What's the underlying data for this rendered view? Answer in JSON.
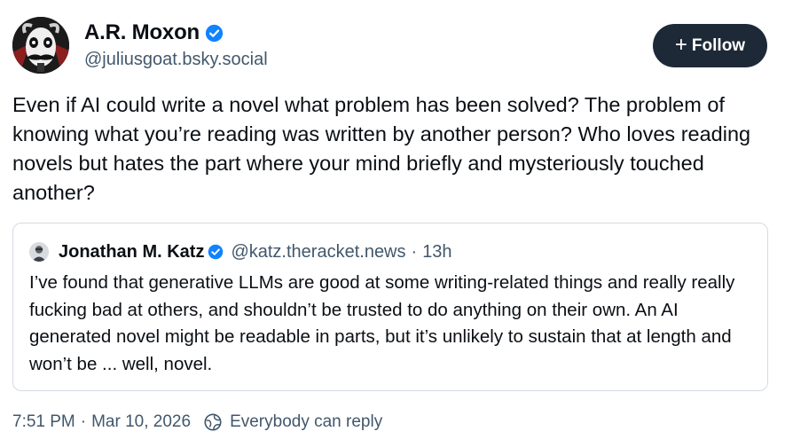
{
  "author": {
    "display_name": "A.R. Moxon",
    "handle": "@juliusgoat.bsky.social",
    "verified": true
  },
  "follow_button": {
    "label": "Follow",
    "icon": "plus-icon"
  },
  "post": {
    "text": "Even if AI could write a novel what problem has been solved? The problem of knowing what you’re reading was written by another person? Who loves reading novels but hates the part where your mind briefly and mysteriously touched another?"
  },
  "quote": {
    "display_name": "Jonathan M. Katz",
    "handle": "@katz.theracket.news",
    "separator": "·",
    "time_ago": "13h",
    "verified": true,
    "text": "I’ve found that generative LLMs are good at some writing-related things and really really fucking bad at others, and shouldn’t be trusted to do anything on their own. An AI generated novel might be readable in parts, but it’s unlikely to sustain that at length and won’t be ... well, novel."
  },
  "meta": {
    "time": "7:51 PM",
    "separator": "·",
    "date": "Mar 10, 2026",
    "reply_setting": "Everybody can reply",
    "reply_icon": "globe-icon"
  },
  "colors": {
    "text": "#0b0f14",
    "muted": "#42576c",
    "verified_blue": "#1083fe",
    "button_bg": "#1e2937",
    "border": "#d4dbe2"
  }
}
